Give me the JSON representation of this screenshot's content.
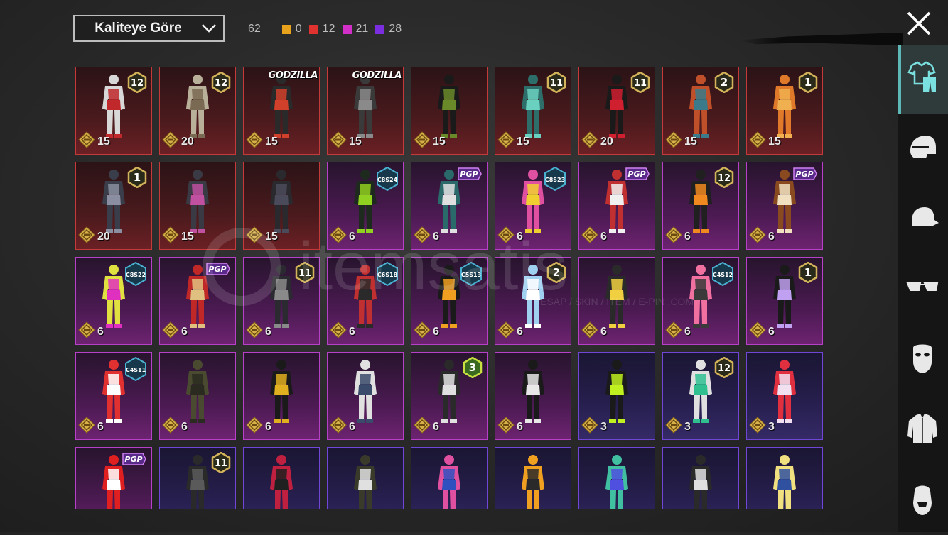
{
  "sort": {
    "label": "Kaliteye Göre"
  },
  "counts": {
    "total": "62",
    "by_rarity": [
      {
        "color": "#e8a21c",
        "value": "0"
      },
      {
        "color": "#e0322e",
        "value": "12"
      },
      {
        "color": "#d22ec8",
        "value": "21"
      },
      {
        "color": "#7a2ee0",
        "value": "28"
      }
    ]
  },
  "watermark": {
    "brand": "itemsatis",
    "tagline": "HESAP / SKIN / ITEM / E-PIN .COM"
  },
  "items": [
    {
      "rarity": "red",
      "badge": "12",
      "price": "15"
    },
    {
      "rarity": "red",
      "badge": "12",
      "price": "20"
    },
    {
      "rarity": "red",
      "badge": "GODZILLA",
      "price": "15"
    },
    {
      "rarity": "red",
      "badge": "GODZILLA",
      "price": "15"
    },
    {
      "rarity": "red",
      "badge": "",
      "price": "15"
    },
    {
      "rarity": "red",
      "badge": "11",
      "price": "15"
    },
    {
      "rarity": "red",
      "badge": "11",
      "price": "20"
    },
    {
      "rarity": "red",
      "badge": "2",
      "price": "15"
    },
    {
      "rarity": "red",
      "badge": "1",
      "price": "15"
    },
    {
      "rarity": "red",
      "badge": "1",
      "price": "20"
    },
    {
      "rarity": "red",
      "badge": "",
      "price": "15"
    },
    {
      "rarity": "red",
      "badge": "",
      "price": "15"
    },
    {
      "rarity": "purple",
      "badge": "C8S24",
      "price": "6"
    },
    {
      "rarity": "purple",
      "badge": "PGP",
      "price": "6"
    },
    {
      "rarity": "purple",
      "badge": "C8S23",
      "price": "6"
    },
    {
      "rarity": "purple",
      "badge": "PGP",
      "price": "6"
    },
    {
      "rarity": "purple",
      "badge": "12",
      "price": "6"
    },
    {
      "rarity": "purple",
      "badge": "PGP",
      "price": "6"
    },
    {
      "rarity": "purple",
      "badge": "C8S22",
      "price": "6"
    },
    {
      "rarity": "purple",
      "badge": "PGP",
      "price": "6"
    },
    {
      "rarity": "purple",
      "badge": "11",
      "price": "6"
    },
    {
      "rarity": "purple",
      "badge": "C6S18",
      "price": "6"
    },
    {
      "rarity": "purple",
      "badge": "C5S13",
      "price": "6"
    },
    {
      "rarity": "purple",
      "badge": "2",
      "price": "6"
    },
    {
      "rarity": "purple",
      "badge": "",
      "price": "6"
    },
    {
      "rarity": "purple",
      "badge": "C4S12",
      "price": "6"
    },
    {
      "rarity": "purple",
      "badge": "1",
      "price": "6"
    },
    {
      "rarity": "purple",
      "badge": "C4S11",
      "price": "6"
    },
    {
      "rarity": "purple",
      "badge": "",
      "price": "6"
    },
    {
      "rarity": "purple",
      "badge": "",
      "price": "6"
    },
    {
      "rarity": "purple",
      "badge": "",
      "price": "6"
    },
    {
      "rarity": "purple",
      "badge": "3",
      "price": "6"
    },
    {
      "rarity": "purple",
      "badge": "",
      "price": "6"
    },
    {
      "rarity": "blue",
      "badge": "",
      "price": "3"
    },
    {
      "rarity": "blue",
      "badge": "12",
      "price": "3"
    },
    {
      "rarity": "blue",
      "badge": "",
      "price": "3"
    },
    {
      "rarity": "purple",
      "badge": "PGP",
      "price": ""
    },
    {
      "rarity": "blue",
      "badge": "11",
      "price": ""
    },
    {
      "rarity": "blue",
      "badge": "",
      "price": ""
    },
    {
      "rarity": "blue",
      "badge": "",
      "price": ""
    },
    {
      "rarity": "blue",
      "badge": "",
      "price": ""
    },
    {
      "rarity": "blue",
      "badge": "",
      "price": ""
    },
    {
      "rarity": "blue",
      "badge": "",
      "price": ""
    },
    {
      "rarity": "blue",
      "badge": "",
      "price": ""
    },
    {
      "rarity": "blue",
      "badge": "",
      "price": ""
    }
  ],
  "sidebar": [
    {
      "icon": "outfit-icon",
      "active": true
    },
    {
      "icon": "helmet-icon",
      "active": false
    },
    {
      "icon": "cap-icon",
      "active": false
    },
    {
      "icon": "glasses-icon",
      "active": false
    },
    {
      "icon": "mask-icon",
      "active": false
    },
    {
      "icon": "jacket-icon",
      "active": false
    },
    {
      "icon": "face-icon",
      "active": false
    }
  ]
}
